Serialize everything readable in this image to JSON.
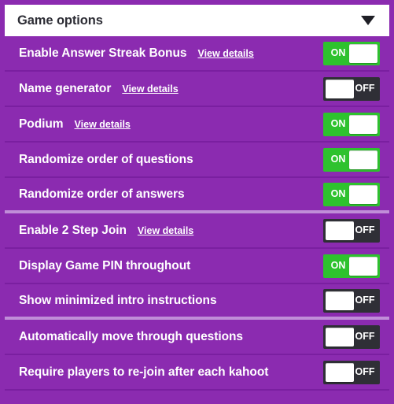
{
  "header": {
    "title": "Game options",
    "caret_icon": "chevron-down-icon"
  },
  "labels": {
    "on": "ON",
    "off": "OFF",
    "view_details": "View details"
  },
  "colors": {
    "panel_purple": "#8b2bb0",
    "row_divider": "#7a1fa0",
    "group_divider": "#c08ed8",
    "toggle_on": "#2ec22e",
    "toggle_off": "#2f2f36",
    "header_background": "#ffffff",
    "header_text": "#2d2d35"
  },
  "options": [
    {
      "label": "Enable Answer Streak Bonus",
      "has_details": true,
      "details_label": "View details",
      "state": "ON",
      "group_end": false
    },
    {
      "label": "Name generator",
      "has_details": true,
      "details_label": "View details",
      "state": "OFF",
      "group_end": false
    },
    {
      "label": "Podium",
      "has_details": true,
      "details_label": "View details",
      "state": "ON",
      "group_end": false
    },
    {
      "label": "Randomize order of questions",
      "has_details": false,
      "details_label": "",
      "state": "ON",
      "group_end": false
    },
    {
      "label": "Randomize order of answers",
      "has_details": false,
      "details_label": "",
      "state": "ON",
      "group_end": true
    },
    {
      "label": "Enable 2 Step Join",
      "has_details": true,
      "details_label": "View details",
      "state": "OFF",
      "group_end": false
    },
    {
      "label": "Display Game PIN throughout",
      "has_details": false,
      "details_label": "",
      "state": "ON",
      "group_end": false
    },
    {
      "label": "Show minimized intro instructions",
      "has_details": false,
      "details_label": "",
      "state": "OFF",
      "group_end": true
    },
    {
      "label": "Automatically move through questions",
      "has_details": false,
      "details_label": "",
      "state": "OFF",
      "group_end": false
    },
    {
      "label": "Require players to re-join after each kahoot",
      "has_details": false,
      "details_label": "",
      "state": "OFF",
      "group_end": false
    }
  ]
}
